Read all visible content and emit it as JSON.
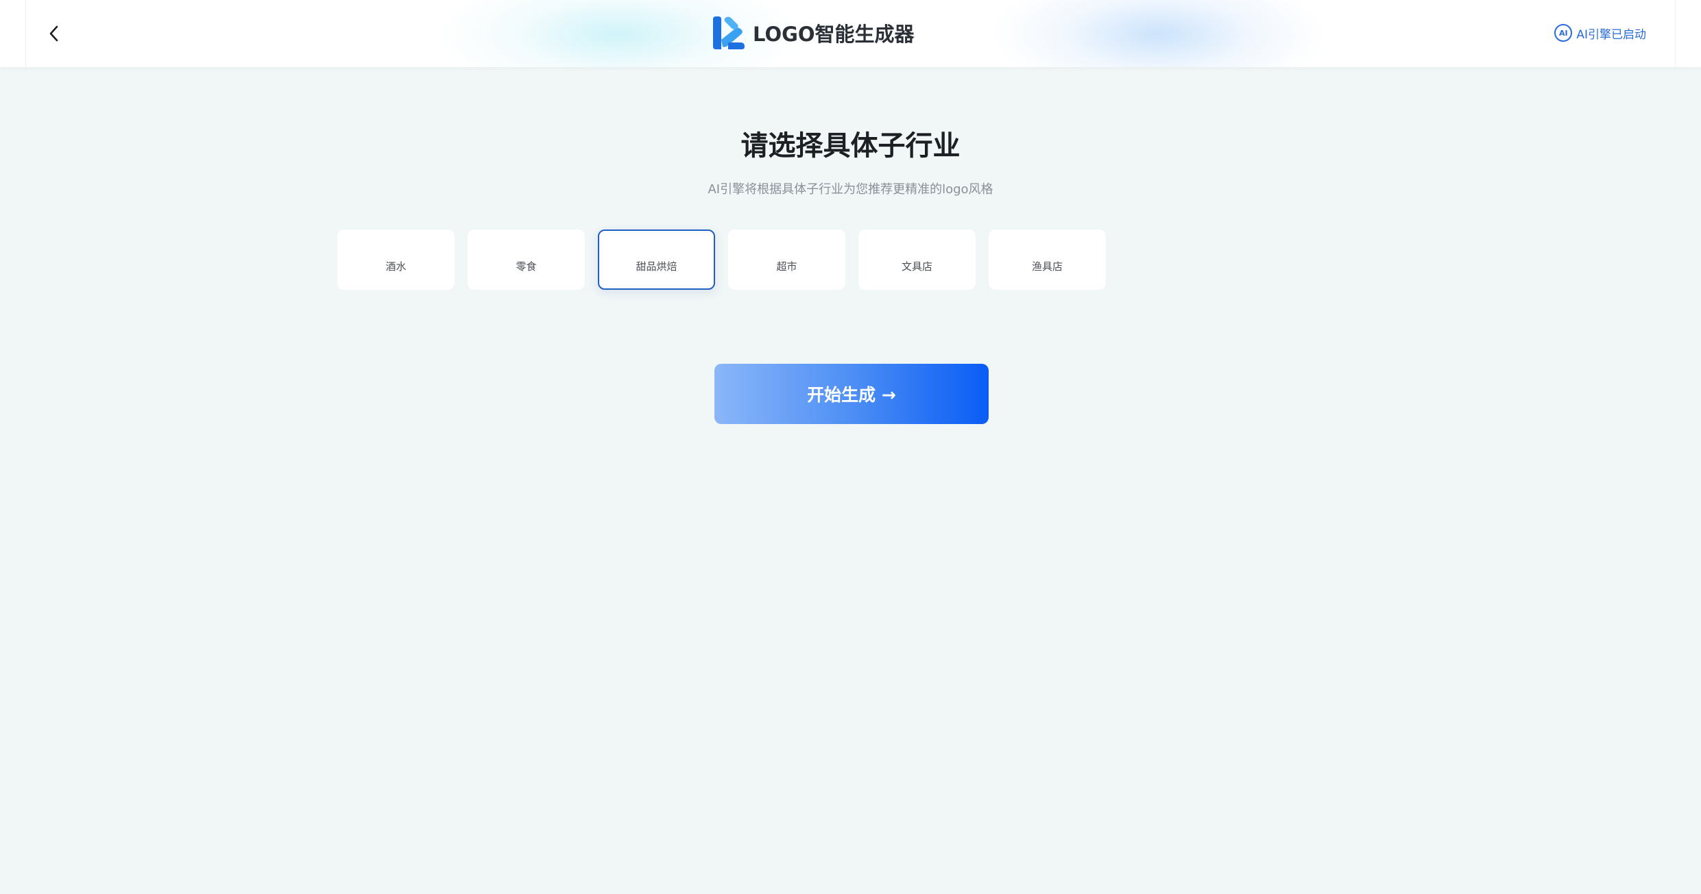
{
  "header": {
    "brand": "LOGO智能生成器",
    "ai_badge": "AI",
    "ai_status": "AI引擎已启动"
  },
  "main": {
    "title": "请选择具体子行业",
    "subtitle": "AI引擎将根据具体子行业为您推荐更精准的logo风格",
    "options": [
      {
        "label": "酒水",
        "selected": false
      },
      {
        "label": "零食",
        "selected": false
      },
      {
        "label": "甜品烘焙",
        "selected": true
      },
      {
        "label": "超市",
        "selected": false
      },
      {
        "label": "文具店",
        "selected": false
      },
      {
        "label": "渔具店",
        "selected": false
      }
    ],
    "start_button": "开始生成 →"
  },
  "colors": {
    "accent": "#1f5fc4",
    "background": "#f1f6f6",
    "button_start": "#8bb6f8",
    "button_end": "#0a5cf5"
  },
  "icons": {
    "back": "chevron-left-icon",
    "logo": "logo-mark-icon",
    "ai": "ai-badge-icon"
  }
}
